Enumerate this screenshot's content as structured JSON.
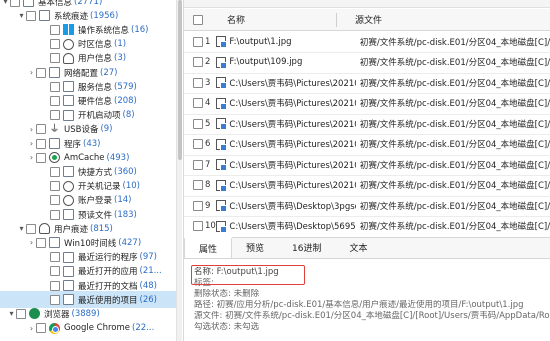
{
  "tree": {
    "items": [
      {
        "label": "基本信息",
        "count": "(2771)",
        "indent": 10,
        "arrow": "▾",
        "icon": "plain",
        "iconName": "folder-icon"
      },
      {
        "label": "系统痕迹",
        "count": "(1956)",
        "indent": 26,
        "arrow": "▾",
        "icon": "plain",
        "iconName": "system-trace-icon"
      },
      {
        "label": "操作系统信息",
        "count": "(16)",
        "indent": 50,
        "arrow": "",
        "icon": "win",
        "iconName": "windows-icon"
      },
      {
        "label": "时区信息",
        "count": "(1)",
        "indent": 50,
        "arrow": "",
        "icon": "circle",
        "iconName": "clock-icon"
      },
      {
        "label": "用户信息",
        "count": "(3)",
        "indent": 50,
        "arrow": "",
        "icon": "user",
        "iconName": "user-icon"
      },
      {
        "label": "网络配置",
        "count": "(27)",
        "indent": 36,
        "arrow": "›",
        "icon": "plain",
        "iconName": "network-icon"
      },
      {
        "label": "服务信息",
        "count": "(579)",
        "indent": 50,
        "arrow": "",
        "icon": "plain",
        "iconName": "service-icon"
      },
      {
        "label": "硬件信息",
        "count": "(208)",
        "indent": 50,
        "arrow": "",
        "icon": "plain",
        "iconName": "hardware-icon"
      },
      {
        "label": "开机启动项",
        "count": "(8)",
        "indent": 50,
        "arrow": "",
        "icon": "plain",
        "iconName": "startup-icon"
      },
      {
        "label": "USB设备",
        "count": "(9)",
        "indent": 36,
        "arrow": "›",
        "icon": "usb",
        "iconName": "usb-icon"
      },
      {
        "label": "程序",
        "count": "(43)",
        "indent": 36,
        "arrow": "›",
        "icon": "plain",
        "iconName": "program-icon"
      },
      {
        "label": "AmCache",
        "count": "(493)",
        "indent": 36,
        "arrow": "›",
        "icon": "amcache",
        "iconName": "amcache-icon"
      },
      {
        "label": "快捷方式",
        "count": "(360)",
        "indent": 50,
        "arrow": "",
        "icon": "plain",
        "iconName": "shortcut-icon"
      },
      {
        "label": "开关机记录",
        "count": "(10)",
        "indent": 50,
        "arrow": "",
        "icon": "circle",
        "iconName": "power-icon"
      },
      {
        "label": "账户登录",
        "count": "(14)",
        "indent": 50,
        "arrow": "",
        "icon": "circle",
        "iconName": "account-login-icon"
      },
      {
        "label": "预读文件",
        "count": "(183)",
        "indent": 50,
        "arrow": "",
        "icon": "plain",
        "iconName": "prefetch-icon"
      },
      {
        "label": "用户痕迹",
        "count": "(815)",
        "indent": 26,
        "arrow": "▾",
        "icon": "user",
        "iconName": "user-trace-icon"
      },
      {
        "label": "Win10时间线",
        "count": "(427)",
        "indent": 36,
        "arrow": "›",
        "icon": "plain",
        "iconName": "timeline-icon"
      },
      {
        "label": "最近运行的程序",
        "count": "(97)",
        "indent": 50,
        "arrow": "",
        "icon": "plain",
        "iconName": "recent-programs-icon"
      },
      {
        "label": "最近打开的应用",
        "count": "(21...",
        "indent": 50,
        "arrow": "",
        "icon": "plain",
        "iconName": "recent-apps-icon"
      },
      {
        "label": "最近打开的文档",
        "count": "(48)",
        "indent": 50,
        "arrow": "",
        "icon": "plain",
        "iconName": "recent-docs-icon"
      },
      {
        "label": "最近使用的项目",
        "count": "(26)",
        "indent": 50,
        "arrow": "",
        "icon": "plain",
        "iconName": "recent-items-icon",
        "selected": true
      },
      {
        "label": "浏览器",
        "count": "(3889)",
        "indent": 16,
        "arrow": "▾",
        "icon": "globe",
        "iconName": "browser-icon"
      },
      {
        "label": "Google Chrome",
        "count": "(22...",
        "indent": 36,
        "arrow": "›",
        "icon": "chrome",
        "iconName": "chrome-icon"
      }
    ]
  },
  "table": {
    "col_name": "名称",
    "col_source": "源文件",
    "rows": [
      {
        "idx": "1",
        "name": "F:\\output\\1.jpg",
        "source": "初赛/文件系统/pc-disk.E01/分区04_本地磁盘[C]/[Root]"
      },
      {
        "idx": "2",
        "name": "F:\\output\\109.jpg",
        "source": "初赛/文件系统/pc-disk.E01/分区04_本地磁盘[C]/[Root]"
      },
      {
        "idx": "3",
        "name": "C:\\Users\\贾韦码\\Pictures\\20210...",
        "source": "初赛/文件系统/pc-disk.E01/分区04_本地磁盘[C]/[Root]"
      },
      {
        "idx": "4",
        "name": "C:\\Users\\贾韦码\\Pictures\\20210...",
        "source": "初赛/文件系统/pc-disk.E01/分区04_本地磁盘[C]/[Root]"
      },
      {
        "idx": "5",
        "name": "C:\\Users\\贾韦码\\Pictures\\20210...",
        "source": "初赛/文件系统/pc-disk.E01/分区04_本地磁盘[C]/[Root]"
      },
      {
        "idx": "6",
        "name": "C:\\Users\\贾韦码\\Pictures\\20210...",
        "source": "初赛/文件系统/pc-disk.E01/分区04_本地磁盘[C]/[Root]"
      },
      {
        "idx": "7",
        "name": "C:\\Users\\贾韦码\\Pictures\\20210...",
        "source": "初赛/文件系统/pc-disk.E01/分区04_本地磁盘[C]/[Root]"
      },
      {
        "idx": "8",
        "name": "C:\\Users\\贾韦码\\Pictures\\20210...",
        "source": "初赛/文件系统/pc-disk.E01/分区04_本地磁盘[C]/[Root]"
      },
      {
        "idx": "9",
        "name": "C:\\Users\\贾韦码\\Desktop\\3pgsc...",
        "source": "初赛/文件系统/pc-disk.E01/分区04_本地磁盘[C]/[Root]"
      },
      {
        "idx": "10",
        "name": "C:\\Users\\贾韦码\\Desktop\\56955...",
        "source": "初赛/文件系统/pc-disk.E01/分区04_本地磁盘[C]/[Root]"
      }
    ]
  },
  "tabs": [
    "属性",
    "预览",
    "16进制",
    "文本"
  ],
  "details": {
    "line1": "名称: F:\\output\\1.jpg",
    "line2": "标签:",
    "line3": "删除状态: 未删除",
    "line4": "路径: 初赛/应用分析/pc-disk.E01/基本信息/用户痕迹/最近使用的项目/F:\\output\\1.jpg",
    "line5": "源文件: 初赛/文件系统/pc-disk.E01/分区04_本地磁盘[C]/[Root]/Users/贾韦码/AppData/Ro",
    "line6": "勾选状态: 未勾选"
  }
}
